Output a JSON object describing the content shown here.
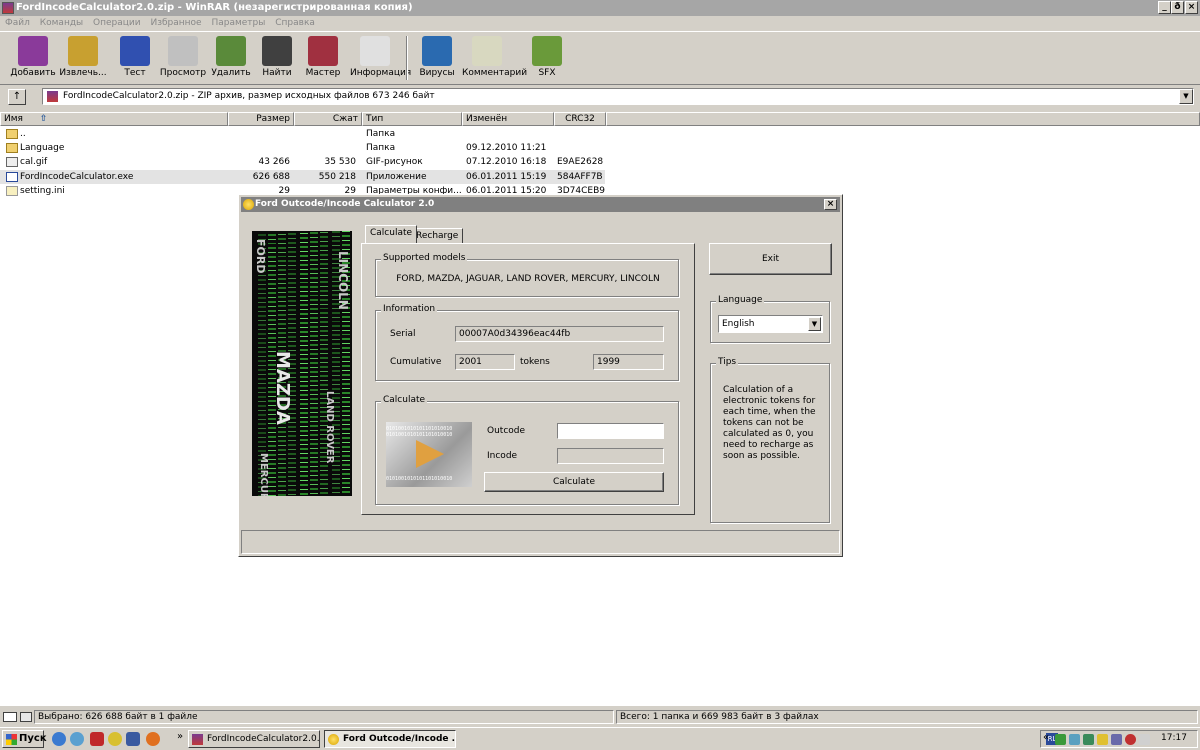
{
  "window": {
    "title": "FordIncodeCalculator2.0.zip - WinRAR (незарегистрированная копия)"
  },
  "window_controls": {
    "minimize": "_",
    "maximize": "ð",
    "close": "×"
  },
  "menu": [
    "Файл",
    "Команды",
    "Операции",
    "Избранное",
    "Параметры",
    "Справка"
  ],
  "toolbar": [
    {
      "label": "Добавить",
      "icon": "add-books-icon",
      "color": "#8a3a9a"
    },
    {
      "label": "Извлечь...",
      "icon": "extract-icon",
      "color": "#c8a030"
    },
    {
      "label": "Тест",
      "icon": "test-icon",
      "color": "#3050b0"
    },
    {
      "label": "Просмотр",
      "icon": "view-glasses-icon",
      "color": "#c0c0c0"
    },
    {
      "label": "Удалить",
      "icon": "delete-icon",
      "color": "#5a8a3a"
    },
    {
      "label": "Найти",
      "icon": "find-binoculars-icon",
      "color": "#404040"
    },
    {
      "label": "Мастер",
      "icon": "wizard-icon",
      "color": "#a03040"
    },
    {
      "label": "Информация",
      "icon": "info-icon",
      "color": "#e0e0e0"
    },
    {
      "label": "Вирусы",
      "icon": "virus-scan-icon",
      "color": "#2a6ab0"
    },
    {
      "label": "Комментарий",
      "icon": "comment-icon",
      "color": "#d8d8c0"
    },
    {
      "label": "SFX",
      "icon": "sfx-icon",
      "color": "#6a9a3a"
    }
  ],
  "address": {
    "text": "FordIncodeCalculator2.0.zip - ZIP архив, размер исходных файлов 673 246 байт",
    "dropdown": "▼"
  },
  "up_button": "↑",
  "columns": [
    "Имя",
    "Размер",
    "Сжат",
    "Тип",
    "Изменён",
    "CRC32"
  ],
  "sort_arrow": "⇧",
  "files": [
    {
      "name": "..",
      "size": "",
      "packed": "",
      "type": "Папка",
      "modified": "",
      "crc": "",
      "icon": "folder-up-icon"
    },
    {
      "name": "Language",
      "size": "",
      "packed": "",
      "type": "Папка",
      "modified": "09.12.2010 11:21",
      "crc": "",
      "icon": "folder-icon"
    },
    {
      "name": "cal.gif",
      "size": "43 266",
      "packed": "35 530",
      "type": "GIF-рисунок",
      "modified": "07.12.2010 16:18",
      "crc": "E9AE2628",
      "icon": "image-file-icon"
    },
    {
      "name": "FordIncodeCalculator.exe",
      "size": "626 688",
      "packed": "550 218",
      "type": "Приложение",
      "modified": "06.01.2011 15:19",
      "crc": "584AFF7B",
      "icon": "exe-file-icon",
      "selected": true
    },
    {
      "name": "setting.ini",
      "size": "29",
      "packed": "29",
      "type": "Параметры конфи...",
      "modified": "06.01.2011 15:20",
      "crc": "3D74CEB9",
      "icon": "ini-file-icon"
    }
  ],
  "status": {
    "left": "Выбрано: 626 688 байт в 1 файле",
    "right": "Всего: 1 папка и 669 983 байт в 3 файлах"
  },
  "dialog": {
    "title": "Ford Outcode/Incode Calculator 2.0",
    "close": "×",
    "banner_words": [
      "FORD",
      "LINCOLN",
      "MAZDA",
      "LAND ROVER",
      "MERCURY"
    ],
    "tabs": [
      "Calculate",
      "Recharge"
    ],
    "supported": {
      "legend": "Supported models",
      "text": "FORD, MAZDA, JAGUAR, LAND ROVER, MERCURY, LINCOLN"
    },
    "information": {
      "legend": "Information",
      "serial_label": "Serial",
      "serial": "00007A0d34396eac44fb",
      "cumulative_label": "Cumulative",
      "cumulative": "2001",
      "tokens_label": "tokens",
      "tokens": "1999"
    },
    "calculate": {
      "legend": "Calculate",
      "outcode_label": "Outcode",
      "outcode": "",
      "incode_label": "Incode",
      "incode": "",
      "button": "Calculate",
      "bits": "0101001010101101010010"
    },
    "exit_button": "Exit",
    "language": {
      "legend": "Language",
      "value": "English",
      "arrow": "▼"
    },
    "tips": {
      "legend": "Tips",
      "text": "Calculation of a electronic tokens for each time, when the tokens can not be calculated as 0, you need to recharge as soon as possible."
    }
  },
  "taskbar": {
    "start": "Пуск",
    "chevron": "»",
    "tasks": [
      "FordIncodeCalculator2.0...",
      "Ford Outcode/Incode ..."
    ],
    "lang": "RL",
    "tray_chevron": "«",
    "clock": "17:17"
  }
}
